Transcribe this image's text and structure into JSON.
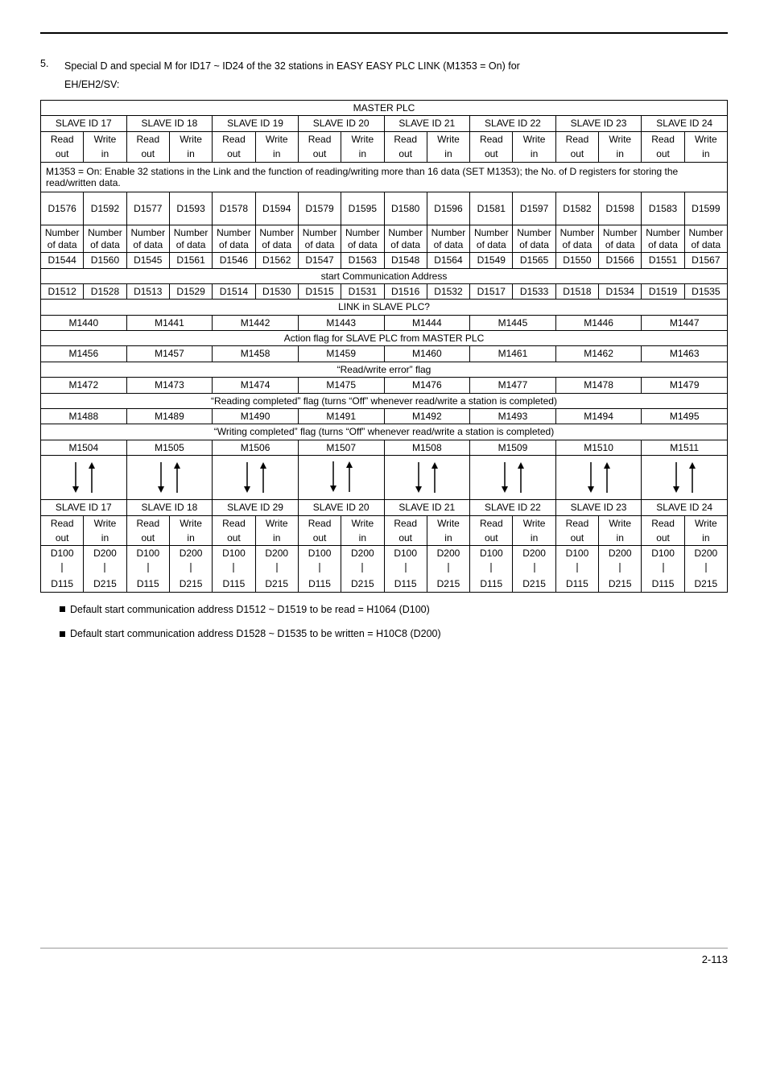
{
  "section_num": "5.",
  "section_text": "Special D and special M for ID17 ~ ID24 of the 32 stations in EASY EASY PLC LINK (M1353 = On) for",
  "section_text2": "EH/EH2/SV:",
  "master_plc": "MASTER PLC",
  "slave_headers": [
    "SLAVE ID 17",
    "SLAVE ID 18",
    "SLAVE ID 19",
    "SLAVE ID 20",
    "SLAVE ID 21",
    "SLAVE ID 22",
    "SLAVE ID 23",
    "SLAVE ID 24"
  ],
  "rw": {
    "read_out": "Read out",
    "write_in": "Write in",
    "read": "Read",
    "write": "Write",
    "out": "out",
    "in": "in"
  },
  "note_line": "M1353 = On: Enable 32 stations in the Link and the function of reading/writing more than 16 data (SET M1353); the No. of D registers for storing the read/written data.",
  "d_row1": [
    "D1576",
    "D1592",
    "D1577",
    "D1593",
    "D1578",
    "D1594",
    "D1579",
    "D1595",
    "D1580",
    "D1596",
    "D1581",
    "D1597",
    "D1582",
    "D1598",
    "D1583",
    "D1599"
  ],
  "num_of_data_row": [
    "Number of data",
    "Number of data",
    "Number of data",
    "Number of data",
    "Number of data",
    "Number of data",
    "Number of data",
    "Number of data",
    "Number of data",
    "Number of data",
    "Number of data",
    "Number of data",
    "Number of data",
    "Number of data",
    "Number of data",
    "Number of data"
  ],
  "d_row2": [
    "D1544",
    "D1560",
    "D1545",
    "D1561",
    "D1546",
    "D1562",
    "D1547",
    "D1563",
    "D1548",
    "D1564",
    "D1549",
    "D1565",
    "D1550",
    "D1566",
    "D1551",
    "D1567"
  ],
  "start_comm": "start Communication Address",
  "d_row3": [
    "D1512",
    "D1528",
    "D1513",
    "D1529",
    "D1514",
    "D1530",
    "D1515",
    "D1531",
    "D1516",
    "D1532",
    "D1517",
    "D1533",
    "D1518",
    "D1534",
    "D1519",
    "D1535"
  ],
  "link_slave": "LINK in SLAVE PLC?",
  "m_row1": [
    "M1440",
    "M1441",
    "M1442",
    "M1443",
    "M1444",
    "M1445",
    "M1446",
    "M1447"
  ],
  "action_flag": "Action flag for SLAVE PLC from MASTER PLC",
  "m_row2": [
    "M1456",
    "M1457",
    "M1458",
    "M1459",
    "M1460",
    "M1461",
    "M1462",
    "M1463"
  ],
  "rw_error": "“Read/write error” flag",
  "m_row3": [
    "M1472",
    "M1473",
    "M1474",
    "M1475",
    "M1476",
    "M1477",
    "M1478",
    "M1479"
  ],
  "reading_completed": "“Reading completed” flag (turns “Off” whenever read/write a station is completed)",
  "m_row4": [
    "M1488",
    "M1489",
    "M1490",
    "M1491",
    "M1492",
    "M1493",
    "M1494",
    "M1495"
  ],
  "writing_completed": "“Writing completed” flag (turns “Off” whenever read/write a station is completed)",
  "m_row5": [
    "M1504",
    "M1505",
    "M1506",
    "M1507",
    "M1508",
    "M1509",
    "M1510",
    "M1511"
  ],
  "slave_headers2": [
    "SLAVE ID 17",
    "SLAVE ID 18",
    "SLAVE ID 29",
    "SLAVE ID 20",
    "SLAVE ID 21",
    "SLAVE ID 22",
    "SLAVE ID 23",
    "SLAVE ID 24"
  ],
  "d100200_row": [
    "D100",
    "D200",
    "D100",
    "D200",
    "D100",
    "D200",
    "D100",
    "D200",
    "D100",
    "D200",
    "D100",
    "D200",
    "D100",
    "D200",
    "D100",
    "D200"
  ],
  "d115215_row": [
    "D115",
    "D215",
    "D115",
    "D215",
    "D115",
    "D215",
    "D115",
    "D215",
    "D115",
    "D215",
    "D115",
    "D215",
    "D115",
    "D215",
    "D115",
    "D215"
  ],
  "bullet1": "Default start communication address D1512 ~ D1519 to be read = H1064 (D100)",
  "bullet2": "Default start communication address D1528 ~ D1535 to be written = H10C8 (D200)",
  "page_num": "2-113"
}
